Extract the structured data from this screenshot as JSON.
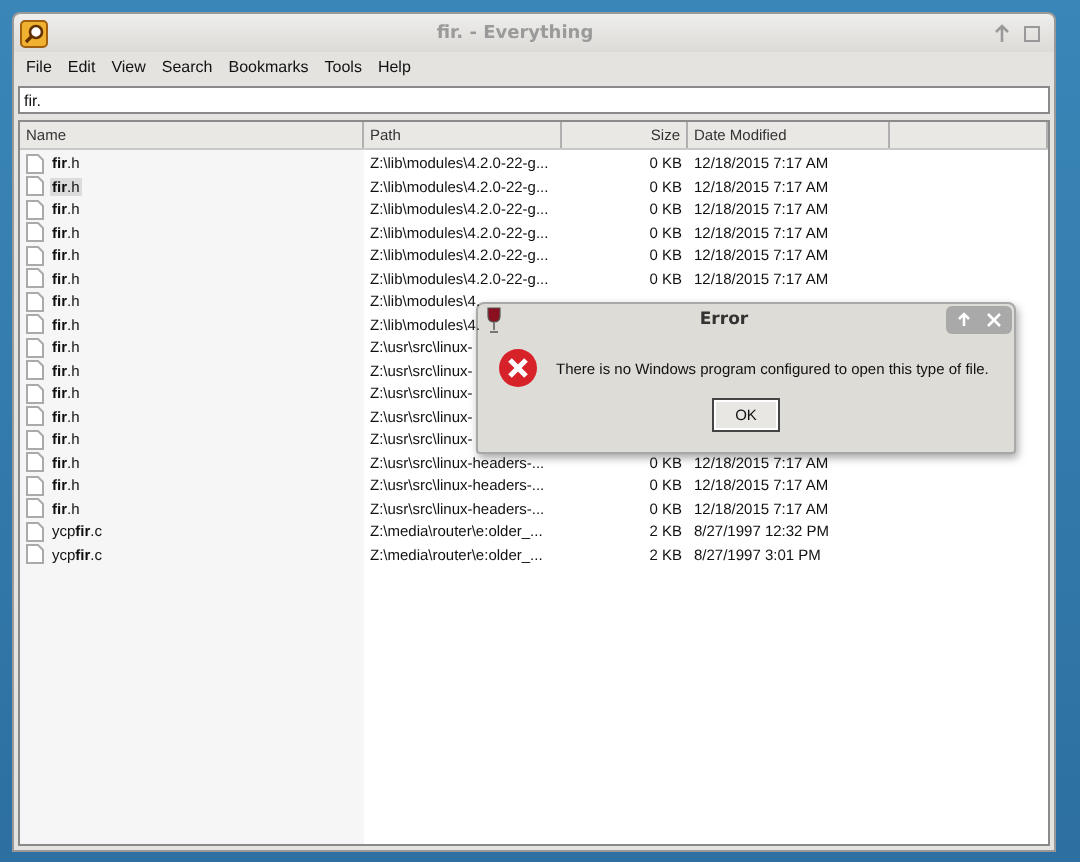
{
  "window": {
    "title": "fir. - Everything"
  },
  "menu": [
    {
      "label": "File"
    },
    {
      "label": "Edit"
    },
    {
      "label": "View"
    },
    {
      "label": "Search"
    },
    {
      "label": "Bookmarks"
    },
    {
      "label": "Tools"
    },
    {
      "label": "Help"
    }
  ],
  "search": {
    "value": "fir."
  },
  "table": {
    "columns": [
      "Name",
      "Path",
      "Size",
      "Date Modified"
    ],
    "rows": [
      {
        "name": "**fir**.h",
        "path": "Z:\\lib\\modules\\4.2.0-22-g...",
        "size": "0 KB",
        "date": "12/18/2015 7:17 AM",
        "selected": false
      },
      {
        "name": "**fir**.h",
        "path": "Z:\\lib\\modules\\4.2.0-22-g...",
        "size": "0 KB",
        "date": "12/18/2015 7:17 AM",
        "selected": true
      },
      {
        "name": "**fir**.h",
        "path": "Z:\\lib\\modules\\4.2.0-22-g...",
        "size": "0 KB",
        "date": "12/18/2015 7:17 AM",
        "selected": false
      },
      {
        "name": "**fir**.h",
        "path": "Z:\\lib\\modules\\4.2.0-22-g...",
        "size": "0 KB",
        "date": "12/18/2015 7:17 AM",
        "selected": false
      },
      {
        "name": "**fir**.h",
        "path": "Z:\\lib\\modules\\4.2.0-22-g...",
        "size": "0 KB",
        "date": "12/18/2015 7:17 AM",
        "selected": false
      },
      {
        "name": "**fir**.h",
        "path": "Z:\\lib\\modules\\4.2.0-22-g...",
        "size": "0 KB",
        "date": "12/18/2015 7:17 AM",
        "selected": false
      },
      {
        "name": "**fir**.h",
        "path": "Z:\\lib\\modules\\4.",
        "selected": false
      },
      {
        "name": "**fir**.h",
        "path": "Z:\\lib\\modules\\4.",
        "selected": false
      },
      {
        "name": "**fir**.h",
        "path": "Z:\\usr\\src\\linux-",
        "selected": false
      },
      {
        "name": "**fir**.h",
        "path": "Z:\\usr\\src\\linux-",
        "selected": false
      },
      {
        "name": "**fir**.h",
        "path": "Z:\\usr\\src\\linux-",
        "selected": false
      },
      {
        "name": "**fir**.h",
        "path": "Z:\\usr\\src\\linux-",
        "selected": false
      },
      {
        "name": "**fir**.h",
        "path": "Z:\\usr\\src\\linux-",
        "selected": false
      },
      {
        "name": "**fir**.h",
        "path": "Z:\\usr\\src\\linux-headers-...",
        "size": "0 KB",
        "date": "12/18/2015 7:17 AM",
        "selected": false
      },
      {
        "name": "**fir**.h",
        "path": "Z:\\usr\\src\\linux-headers-...",
        "size": "0 KB",
        "date": "12/18/2015 7:17 AM",
        "selected": false
      },
      {
        "name": "**fir**.h",
        "path": "Z:\\usr\\src\\linux-headers-...",
        "size": "0 KB",
        "date": "12/18/2015 7:17 AM",
        "selected": false
      },
      {
        "name": "ycp**fir**.c",
        "path": "Z:\\media\\router\\e:older_...",
        "size": "2 KB",
        "date": "8/27/1997 12:32 PM",
        "selected": false
      },
      {
        "name": "ycp**fir**.c",
        "path": "Z:\\media\\router\\e:older_...",
        "size": "2 KB",
        "date": "8/27/1997 3:01 PM",
        "selected": false
      }
    ]
  },
  "dialog": {
    "title": "Error",
    "message": "There is no Windows program configured to open this type of file.",
    "buttons": [
      "OK"
    ]
  }
}
